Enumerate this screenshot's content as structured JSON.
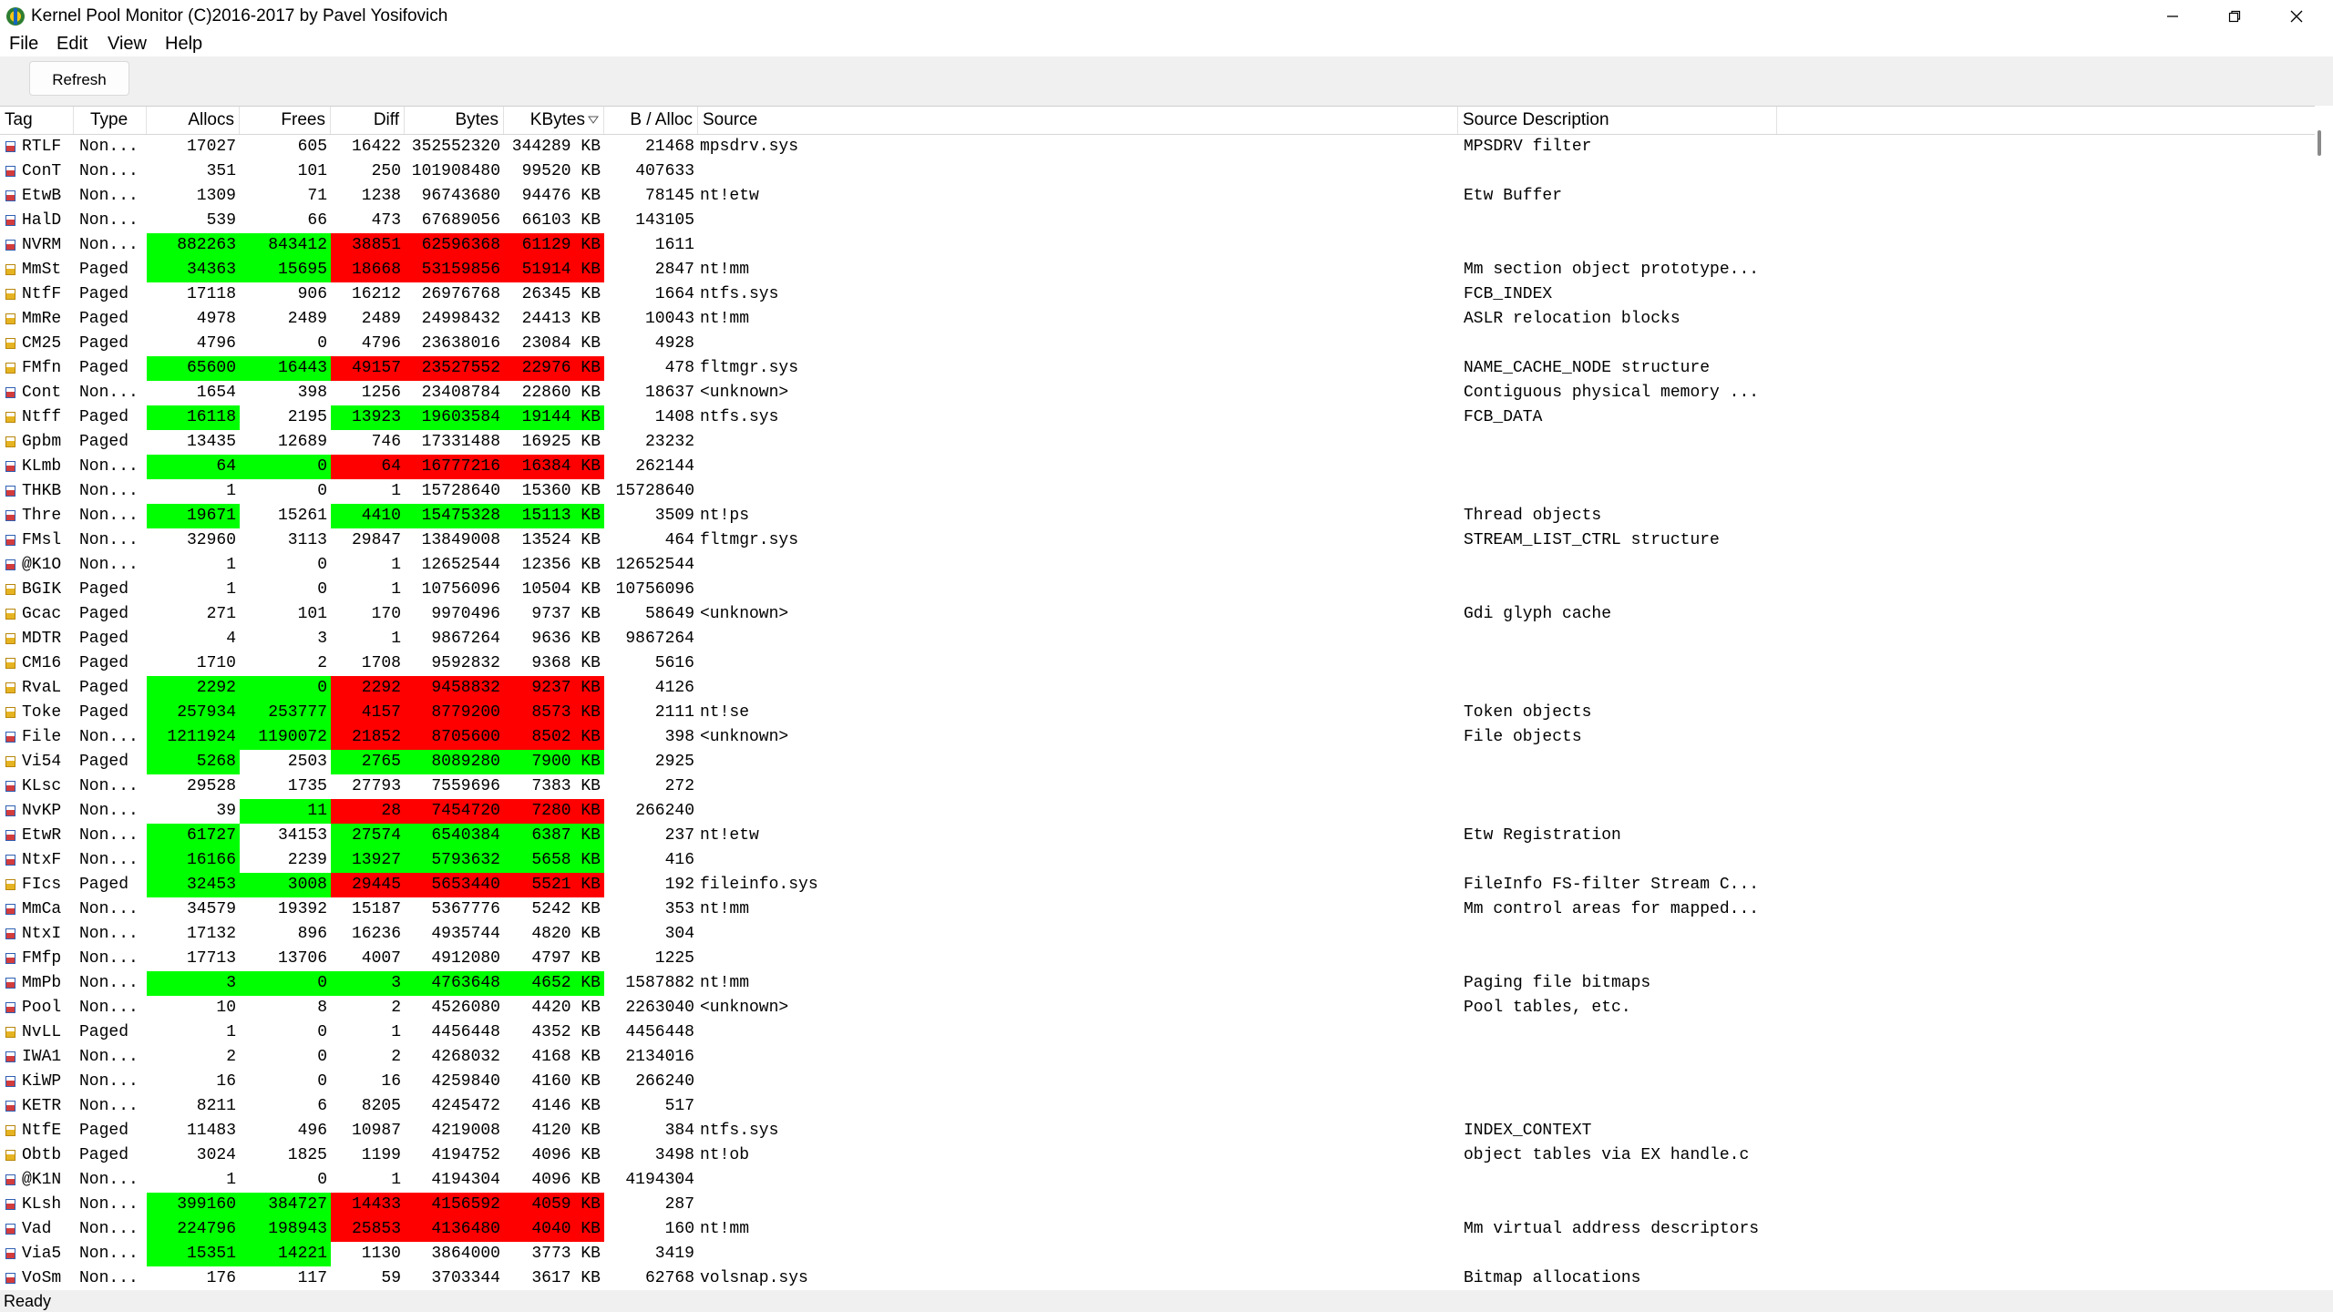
{
  "window": {
    "title": "Kernel Pool Monitor (C)2016-2017 by Pavel Yosifovich",
    "icon": "app-icon",
    "controls": [
      "minimize-icon",
      "restore-icon",
      "close-icon"
    ]
  },
  "menu": [
    "File",
    "Edit",
    "View",
    "Help"
  ],
  "toolbar": {
    "refresh_label": "Refresh"
  },
  "table": {
    "columns": [
      {
        "key": "tag",
        "label": "Tag"
      },
      {
        "key": "type",
        "label": "Type"
      },
      {
        "key": "allocs",
        "label": "Allocs"
      },
      {
        "key": "frees",
        "label": "Frees"
      },
      {
        "key": "diff",
        "label": "Diff"
      },
      {
        "key": "bytes",
        "label": "Bytes"
      },
      {
        "key": "kbytes",
        "label": "KBytes"
      },
      {
        "key": "bpa",
        "label": "B / Alloc"
      },
      {
        "key": "source",
        "label": "Source"
      },
      {
        "key": "desc",
        "label": "Source Description"
      }
    ],
    "sort_column": "KBytes",
    "sort_direction": "descending",
    "highlight_colors": {
      "green": "#00ff00",
      "red": "#ff0000"
    },
    "rows": [
      {
        "tag": "RTLF",
        "type": "Non...",
        "allocs": "17027",
        "frees": "605",
        "diff": "16422",
        "bytes": "352552320",
        "kbytes": "344289 KB",
        "bpa": "21468",
        "source": "mpsdrv.sys",
        "desc": "MPSDRV filter"
      },
      {
        "tag": "ConT",
        "type": "Non...",
        "allocs": "351",
        "frees": "101",
        "diff": "250",
        "bytes": "101908480",
        "kbytes": "99520 KB",
        "bpa": "407633",
        "source": "",
        "desc": ""
      },
      {
        "tag": "EtwB",
        "type": "Non...",
        "allocs": "1309",
        "frees": "71",
        "diff": "1238",
        "bytes": "96743680",
        "kbytes": "94476 KB",
        "bpa": "78145",
        "source": "nt!etw",
        "desc": "Etw Buffer"
      },
      {
        "tag": "HalD",
        "type": "Non...",
        "allocs": "539",
        "frees": "66",
        "diff": "473",
        "bytes": "67689056",
        "kbytes": "66103 KB",
        "bpa": "143105",
        "source": "",
        "desc": ""
      },
      {
        "tag": "NVRM",
        "type": "Non...",
        "allocs": "882263",
        "frees": "843412",
        "diff": "38851",
        "bytes": "62596368",
        "kbytes": "61129 KB",
        "bpa": "1611",
        "source": "",
        "desc": "",
        "hl": {
          "allocs": "green",
          "frees": "green",
          "diff": "red",
          "bytes": "red",
          "kbytes": "red"
        }
      },
      {
        "tag": "MmSt",
        "type": "Paged",
        "allocs": "34363",
        "frees": "15695",
        "diff": "18668",
        "bytes": "53159856",
        "kbytes": "51914 KB",
        "bpa": "2847",
        "source": "nt!mm",
        "desc": "Mm section object prototype...",
        "hl": {
          "allocs": "green",
          "frees": "green",
          "diff": "red",
          "bytes": "red",
          "kbytes": "red"
        }
      },
      {
        "tag": "NtfF",
        "type": "Paged",
        "allocs": "17118",
        "frees": "906",
        "diff": "16212",
        "bytes": "26976768",
        "kbytes": "26345 KB",
        "bpa": "1664",
        "source": "ntfs.sys",
        "desc": "FCB_INDEX"
      },
      {
        "tag": "MmRe",
        "type": "Paged",
        "allocs": "4978",
        "frees": "2489",
        "diff": "2489",
        "bytes": "24998432",
        "kbytes": "24413 KB",
        "bpa": "10043",
        "source": "nt!mm",
        "desc": "ASLR relocation blocks"
      },
      {
        "tag": "CM25",
        "type": "Paged",
        "allocs": "4796",
        "frees": "0",
        "diff": "4796",
        "bytes": "23638016",
        "kbytes": "23084 KB",
        "bpa": "4928",
        "source": "",
        "desc": ""
      },
      {
        "tag": "FMfn",
        "type": "Paged",
        "allocs": "65600",
        "frees": "16443",
        "diff": "49157",
        "bytes": "23527552",
        "kbytes": "22976 KB",
        "bpa": "478",
        "source": "fltmgr.sys",
        "desc": "NAME_CACHE_NODE structure",
        "hl": {
          "allocs": "green",
          "frees": "green",
          "diff": "red",
          "bytes": "red",
          "kbytes": "red"
        }
      },
      {
        "tag": "Cont",
        "type": "Non...",
        "allocs": "1654",
        "frees": "398",
        "diff": "1256",
        "bytes": "23408784",
        "kbytes": "22860 KB",
        "bpa": "18637",
        "source": "<unknown>",
        "desc": "Contiguous physical memory ..."
      },
      {
        "tag": "Ntff",
        "type": "Paged",
        "allocs": "16118",
        "frees": "2195",
        "diff": "13923",
        "bytes": "19603584",
        "kbytes": "19144 KB",
        "bpa": "1408",
        "source": "ntfs.sys",
        "desc": "FCB_DATA",
        "hl": {
          "allocs": "green",
          "diff": "green",
          "bytes": "green",
          "kbytes": "green"
        }
      },
      {
        "tag": "Gpbm",
        "type": "Paged",
        "allocs": "13435",
        "frees": "12689",
        "diff": "746",
        "bytes": "17331488",
        "kbytes": "16925 KB",
        "bpa": "23232",
        "source": "",
        "desc": ""
      },
      {
        "tag": "KLmb",
        "type": "Non...",
        "allocs": "64",
        "frees": "0",
        "diff": "64",
        "bytes": "16777216",
        "kbytes": "16384 KB",
        "bpa": "262144",
        "source": "",
        "desc": "",
        "hl": {
          "allocs": "green",
          "frees": "green",
          "diff": "red",
          "bytes": "red",
          "kbytes": "red"
        }
      },
      {
        "tag": "THKB",
        "type": "Non...",
        "allocs": "1",
        "frees": "0",
        "diff": "1",
        "bytes": "15728640",
        "kbytes": "15360 KB",
        "bpa": "15728640",
        "source": "",
        "desc": ""
      },
      {
        "tag": "Thre",
        "type": "Non...",
        "allocs": "19671",
        "frees": "15261",
        "diff": "4410",
        "bytes": "15475328",
        "kbytes": "15113 KB",
        "bpa": "3509",
        "source": "nt!ps",
        "desc": "Thread objects",
        "hl": {
          "allocs": "green",
          "diff": "green",
          "bytes": "green",
          "kbytes": "green"
        }
      },
      {
        "tag": "FMsl",
        "type": "Non...",
        "allocs": "32960",
        "frees": "3113",
        "diff": "29847",
        "bytes": "13849008",
        "kbytes": "13524 KB",
        "bpa": "464",
        "source": "fltmgr.sys",
        "desc": "STREAM_LIST_CTRL structure"
      },
      {
        "tag": "@K1O",
        "type": "Non...",
        "allocs": "1",
        "frees": "0",
        "diff": "1",
        "bytes": "12652544",
        "kbytes": "12356 KB",
        "bpa": "12652544",
        "source": "",
        "desc": ""
      },
      {
        "tag": "BGIK",
        "type": "Paged",
        "allocs": "1",
        "frees": "0",
        "diff": "1",
        "bytes": "10756096",
        "kbytes": "10504 KB",
        "bpa": "10756096",
        "source": "",
        "desc": ""
      },
      {
        "tag": "Gcac",
        "type": "Paged",
        "allocs": "271",
        "frees": "101",
        "diff": "170",
        "bytes": "9970496",
        "kbytes": "9737 KB",
        "bpa": "58649",
        "source": "<unknown>",
        "desc": "Gdi glyph cache"
      },
      {
        "tag": "MDTR",
        "type": "Paged",
        "allocs": "4",
        "frees": "3",
        "diff": "1",
        "bytes": "9867264",
        "kbytes": "9636 KB",
        "bpa": "9867264",
        "source": "",
        "desc": ""
      },
      {
        "tag": "CM16",
        "type": "Paged",
        "allocs": "1710",
        "frees": "2",
        "diff": "1708",
        "bytes": "9592832",
        "kbytes": "9368 KB",
        "bpa": "5616",
        "source": "",
        "desc": ""
      },
      {
        "tag": "RvaL",
        "type": "Paged",
        "allocs": "2292",
        "frees": "0",
        "diff": "2292",
        "bytes": "9458832",
        "kbytes": "9237 KB",
        "bpa": "4126",
        "source": "",
        "desc": "",
        "hl": {
          "allocs": "green",
          "frees": "green",
          "diff": "red",
          "bytes": "red",
          "kbytes": "red"
        }
      },
      {
        "tag": "Toke",
        "type": "Paged",
        "allocs": "257934",
        "frees": "253777",
        "diff": "4157",
        "bytes": "8779200",
        "kbytes": "8573 KB",
        "bpa": "2111",
        "source": "nt!se",
        "desc": "Token objects",
        "hl": {
          "allocs": "green",
          "frees": "green",
          "diff": "red",
          "bytes": "red",
          "kbytes": "red"
        }
      },
      {
        "tag": "File",
        "type": "Non...",
        "allocs": "1211924",
        "frees": "1190072",
        "diff": "21852",
        "bytes": "8705600",
        "kbytes": "8502 KB",
        "bpa": "398",
        "source": "<unknown>",
        "desc": "File objects",
        "hl": {
          "allocs": "green",
          "frees": "green",
          "diff": "red",
          "bytes": "red",
          "kbytes": "red"
        }
      },
      {
        "tag": "Vi54",
        "type": "Paged",
        "allocs": "5268",
        "frees": "2503",
        "diff": "2765",
        "bytes": "8089280",
        "kbytes": "7900 KB",
        "bpa": "2925",
        "source": "",
        "desc": "",
        "hl": {
          "allocs": "green",
          "diff": "green",
          "bytes": "green",
          "kbytes": "green"
        }
      },
      {
        "tag": "KLsc",
        "type": "Non...",
        "allocs": "29528",
        "frees": "1735",
        "diff": "27793",
        "bytes": "7559696",
        "kbytes": "7383 KB",
        "bpa": "272",
        "source": "",
        "desc": ""
      },
      {
        "tag": "NvKP",
        "type": "Non...",
        "allocs": "39",
        "frees": "11",
        "diff": "28",
        "bytes": "7454720",
        "kbytes": "7280 KB",
        "bpa": "266240",
        "source": "",
        "desc": "",
        "hl": {
          "frees": "green",
          "diff": "red",
          "bytes": "red",
          "kbytes": "red"
        }
      },
      {
        "tag": "EtwR",
        "type": "Non...",
        "allocs": "61727",
        "frees": "34153",
        "diff": "27574",
        "bytes": "6540384",
        "kbytes": "6387 KB",
        "bpa": "237",
        "source": "nt!etw",
        "desc": "Etw Registration",
        "hl": {
          "allocs": "green",
          "diff": "green",
          "bytes": "green",
          "kbytes": "green"
        }
      },
      {
        "tag": "NtxF",
        "type": "Non...",
        "allocs": "16166",
        "frees": "2239",
        "diff": "13927",
        "bytes": "5793632",
        "kbytes": "5658 KB",
        "bpa": "416",
        "source": "",
        "desc": "",
        "hl": {
          "allocs": "green",
          "diff": "green",
          "bytes": "green",
          "kbytes": "green"
        }
      },
      {
        "tag": "FIcs",
        "type": "Paged",
        "allocs": "32453",
        "frees": "3008",
        "diff": "29445",
        "bytes": "5653440",
        "kbytes": "5521 KB",
        "bpa": "192",
        "source": "fileinfo.sys",
        "desc": "FileInfo FS-filter Stream C...",
        "hl": {
          "allocs": "green",
          "frees": "green",
          "diff": "red",
          "bytes": "red",
          "kbytes": "red"
        }
      },
      {
        "tag": "MmCa",
        "type": "Non...",
        "allocs": "34579",
        "frees": "19392",
        "diff": "15187",
        "bytes": "5367776",
        "kbytes": "5242 KB",
        "bpa": "353",
        "source": "nt!mm",
        "desc": "Mm control areas for mapped..."
      },
      {
        "tag": "NtxI",
        "type": "Non...",
        "allocs": "17132",
        "frees": "896",
        "diff": "16236",
        "bytes": "4935744",
        "kbytes": "4820 KB",
        "bpa": "304",
        "source": "",
        "desc": ""
      },
      {
        "tag": "FMfp",
        "type": "Non...",
        "allocs": "17713",
        "frees": "13706",
        "diff": "4007",
        "bytes": "4912080",
        "kbytes": "4797 KB",
        "bpa": "1225",
        "source": "",
        "desc": ""
      },
      {
        "tag": "MmPb",
        "type": "Non...",
        "allocs": "3",
        "frees": "0",
        "diff": "3",
        "bytes": "4763648",
        "kbytes": "4652 KB",
        "bpa": "1587882",
        "source": "nt!mm",
        "desc": "Paging file bitmaps",
        "hl": {
          "allocs": "green",
          "frees": "green",
          "diff": "green",
          "bytes": "green",
          "kbytes": "green"
        }
      },
      {
        "tag": "Pool",
        "type": "Non...",
        "allocs": "10",
        "frees": "8",
        "diff": "2",
        "bytes": "4526080",
        "kbytes": "4420 KB",
        "bpa": "2263040",
        "source": "<unknown>",
        "desc": "Pool tables, etc."
      },
      {
        "tag": "NvLL",
        "type": "Paged",
        "allocs": "1",
        "frees": "0",
        "diff": "1",
        "bytes": "4456448",
        "kbytes": "4352 KB",
        "bpa": "4456448",
        "source": "",
        "desc": ""
      },
      {
        "tag": "IWA1",
        "type": "Non...",
        "allocs": "2",
        "frees": "0",
        "diff": "2",
        "bytes": "4268032",
        "kbytes": "4168 KB",
        "bpa": "2134016",
        "source": "",
        "desc": ""
      },
      {
        "tag": "KiWP",
        "type": "Non...",
        "allocs": "16",
        "frees": "0",
        "diff": "16",
        "bytes": "4259840",
        "kbytes": "4160 KB",
        "bpa": "266240",
        "source": "",
        "desc": ""
      },
      {
        "tag": "KETR",
        "type": "Non...",
        "allocs": "8211",
        "frees": "6",
        "diff": "8205",
        "bytes": "4245472",
        "kbytes": "4146 KB",
        "bpa": "517",
        "source": "",
        "desc": ""
      },
      {
        "tag": "NtfE",
        "type": "Paged",
        "allocs": "11483",
        "frees": "496",
        "diff": "10987",
        "bytes": "4219008",
        "kbytes": "4120 KB",
        "bpa": "384",
        "source": "ntfs.sys",
        "desc": "INDEX_CONTEXT"
      },
      {
        "tag": "Obtb",
        "type": "Paged",
        "allocs": "3024",
        "frees": "1825",
        "diff": "1199",
        "bytes": "4194752",
        "kbytes": "4096 KB",
        "bpa": "3498",
        "source": "nt!ob",
        "desc": "object tables via EX handle.c"
      },
      {
        "tag": "@K1N",
        "type": "Non...",
        "allocs": "1",
        "frees": "0",
        "diff": "1",
        "bytes": "4194304",
        "kbytes": "4096 KB",
        "bpa": "4194304",
        "source": "",
        "desc": ""
      },
      {
        "tag": "KLsh",
        "type": "Non...",
        "allocs": "399160",
        "frees": "384727",
        "diff": "14433",
        "bytes": "4156592",
        "kbytes": "4059 KB",
        "bpa": "287",
        "source": "",
        "desc": "",
        "hl": {
          "allocs": "green",
          "frees": "green",
          "diff": "red",
          "bytes": "red",
          "kbytes": "red"
        }
      },
      {
        "tag": "Vad",
        "type": "Non...",
        "allocs": "224796",
        "frees": "198943",
        "diff": "25853",
        "bytes": "4136480",
        "kbytes": "4040 KB",
        "bpa": "160",
        "source": "nt!mm",
        "desc": "Mm virtual address descriptors",
        "hl": {
          "allocs": "green",
          "frees": "green",
          "diff": "red",
          "bytes": "red",
          "kbytes": "red"
        }
      },
      {
        "tag": "Via5",
        "type": "Non...",
        "allocs": "15351",
        "frees": "14221",
        "diff": "1130",
        "bytes": "3864000",
        "kbytes": "3773 KB",
        "bpa": "3419",
        "source": "",
        "desc": "",
        "hl": {
          "allocs": "green",
          "frees": "green"
        }
      },
      {
        "tag": "VoSm",
        "type": "Non...",
        "allocs": "176",
        "frees": "117",
        "diff": "59",
        "bytes": "3703344",
        "kbytes": "3617 KB",
        "bpa": "62768",
        "source": "volsnap.sys",
        "desc": "Bitmap allocations"
      }
    ]
  },
  "status": {
    "text": "Ready"
  }
}
